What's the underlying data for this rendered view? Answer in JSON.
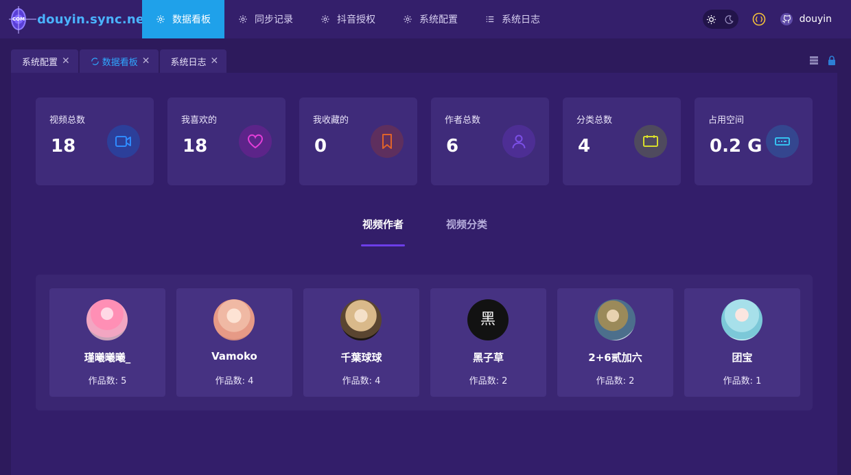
{
  "app": {
    "logo_text": "douyin.sync.net",
    "logo_mark_text": "COM"
  },
  "nav": {
    "items": [
      {
        "label": "数据看板",
        "icon": "gear-icon"
      },
      {
        "label": "同步记录",
        "icon": "gear-icon"
      },
      {
        "label": "抖音授权",
        "icon": "gear-icon"
      },
      {
        "label": "系统配置",
        "icon": "gear-icon"
      },
      {
        "label": "系统日志",
        "icon": "list-icon"
      }
    ],
    "user": "douyin",
    "accent": "#1fa1ea"
  },
  "tabs": [
    {
      "label": "系统配置"
    },
    {
      "label": "数据看板"
    },
    {
      "label": "系统日志"
    }
  ],
  "stats": [
    {
      "label": "视频总数",
      "value": "18",
      "icon": "video-icon",
      "color": "#2f8bff"
    },
    {
      "label": "我喜欢的",
      "value": "18",
      "icon": "heart-icon",
      "color": "#e33ed8"
    },
    {
      "label": "我收藏的",
      "value": "0",
      "icon": "bookmark-icon",
      "color": "#e0632a"
    },
    {
      "label": "作者总数",
      "value": "6",
      "icon": "user-icon",
      "color": "#7b4fe6"
    },
    {
      "label": "分类总数",
      "value": "4",
      "icon": "tag-icon",
      "color": "#d8de2b"
    },
    {
      "label": "占用空间",
      "value": "0.2 G",
      "icon": "storage-icon",
      "color": "#35c2f0"
    }
  ],
  "switch": {
    "authors": "视频作者",
    "categories": "视频分类"
  },
  "authors": [
    {
      "name": "瑾曦曦曦_",
      "works": "作品数: 5"
    },
    {
      "name": "Vamoko",
      "works": "作品数: 4"
    },
    {
      "name": "千葉球球",
      "works": "作品数: 4"
    },
    {
      "name": "黑子草",
      "works": "作品数: 2"
    },
    {
      "name": "2+6贰加六",
      "works": "作品数: 2"
    },
    {
      "name": "团宝",
      "works": "作品数: 1"
    }
  ]
}
